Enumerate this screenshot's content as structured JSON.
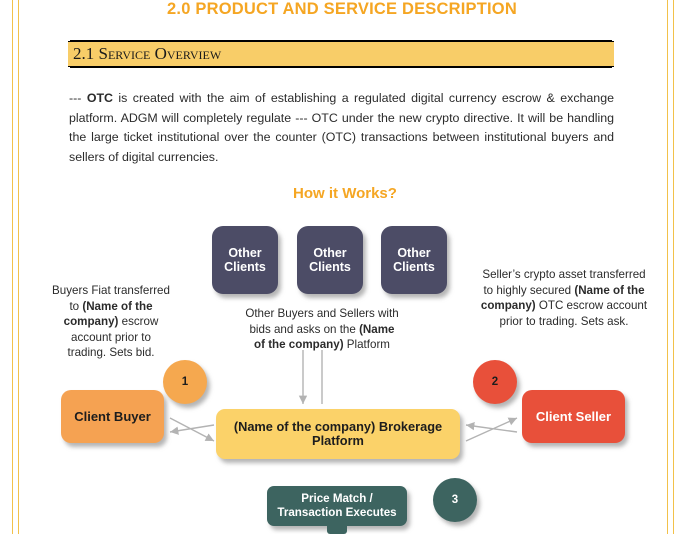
{
  "document": {
    "title": "2.0 PRODUCT AND SERVICE DESCRIPTION",
    "section_heading": "2.1 Service Overview",
    "paragraph_parts": {
      "p1": "--- ",
      "p2_bold": "OTC",
      "p3": " is created with the aim of establishing a regulated digital currency escrow & exchange platform. ADGM will completely regulate --- OTC under the new crypto directive. It will be handling the large ticket institutional over the counter (OTC) transactions between institutional buyers and sellers of digital currencies."
    }
  },
  "diagram": {
    "title": "How it Works?",
    "other_clients": [
      {
        "label_line1": "Other",
        "label_line2": "Clients"
      },
      {
        "label_line1": "Other",
        "label_line2": "Clients"
      },
      {
        "label_line1": "Other",
        "label_line2": "Clients"
      }
    ],
    "nodes": {
      "client_buyer": "Client Buyer",
      "client_seller": "Client Seller",
      "brokerage_line1": "(Name of the company)  Brokerage",
      "brokerage_line2": "Platform",
      "price_match_line1": "Price Match /",
      "price_match_line2": "Transaction Executes"
    },
    "step_numbers": {
      "one": "1",
      "two": "2",
      "three": "3"
    },
    "annotations": {
      "left": {
        "t1": "Buyers Fiat transferred to ",
        "t2_bold": "(Name of the company)",
        "t3": " escrow account prior to trading. Sets bid."
      },
      "center": {
        "t1": "Other Buyers and Sellers with bids and asks on the ",
        "t2_bold": "(Name of the company)",
        "t3": " Platform"
      },
      "right": {
        "t1": "Seller’s crypto asset transferred to highly secured ",
        "t2_bold": "(Name of the company)",
        "t3": " OTC escrow account prior to trading. Sets ask."
      }
    }
  },
  "colors": {
    "gold_title": "#f5a623",
    "band_gold": "#f8cd68",
    "slate": "#4c4c66",
    "orange": "#f5a252",
    "red": "#e8503a",
    "yellow": "#fbd269",
    "teal": "#3d6460",
    "arrow_gray": "#b3b3b3",
    "page_border": "#f2c14a"
  }
}
